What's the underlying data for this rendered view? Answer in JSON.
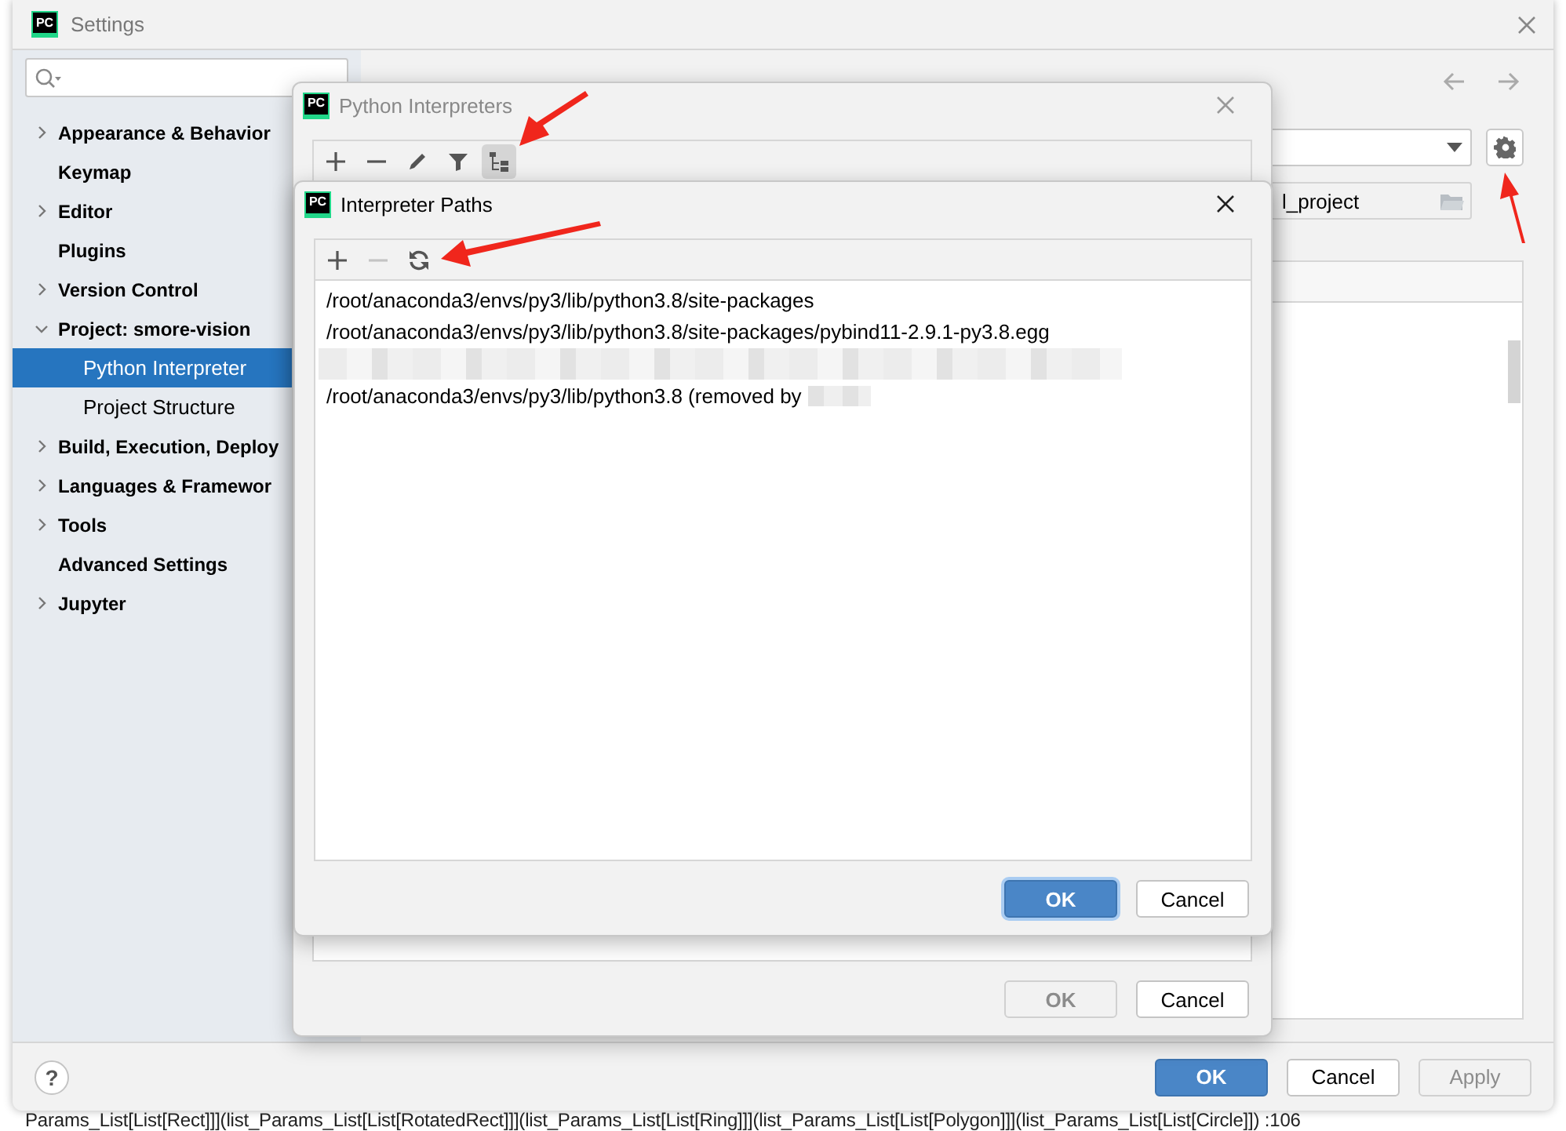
{
  "background_text": "Params_List[List[Rect]]](list_Params_List[List[RotatedRect]]](list_Params_List[List[Ring]]](list_Params_List[List[Polygon]]](list_Params_List[List[Circle]]) :106",
  "window": {
    "logo": "PC",
    "title": "Settings"
  },
  "sidebar": {
    "items": [
      {
        "label": "Appearance & Behavior",
        "kind": "group",
        "expanded": false,
        "selected": false
      },
      {
        "label": "Keymap",
        "kind": "page",
        "selected": false
      },
      {
        "label": "Editor",
        "kind": "group",
        "expanded": false,
        "selected": false
      },
      {
        "label": "Plugins",
        "kind": "page",
        "selected": false
      },
      {
        "label": "Version Control",
        "kind": "group",
        "expanded": false,
        "selected": false
      },
      {
        "label": "Project: smore-vision",
        "kind": "group",
        "expanded": true,
        "selected": false,
        "children": [
          {
            "label": "Python Interpreter",
            "selected": true
          },
          {
            "label": "Project Structure",
            "selected": false
          }
        ]
      },
      {
        "label": "Build, Execution, Deploy",
        "kind": "group",
        "expanded": false,
        "selected": false
      },
      {
        "label": "Languages & Framewor",
        "kind": "group",
        "expanded": false,
        "selected": false
      },
      {
        "label": "Tools",
        "kind": "group",
        "expanded": false,
        "selected": false
      },
      {
        "label": "Advanced Settings",
        "kind": "page",
        "selected": false
      },
      {
        "label": "Jupyter",
        "kind": "group",
        "expanded": false,
        "selected": false
      }
    ]
  },
  "content": {
    "project_field": {
      "value": "l_project"
    }
  },
  "help_button": {
    "label": "?"
  },
  "buttons": [
    {
      "label": "OK",
      "kind": "primary",
      "disabled": false
    },
    {
      "label": "Cancel",
      "kind": "normal",
      "disabled": false
    },
    {
      "label": "Apply",
      "kind": "normal",
      "disabled": true
    }
  ],
  "dialogs": [
    {
      "logo": "PC",
      "title": "Python Interpreters",
      "active": false,
      "toolbar": [
        {
          "kind": "add",
          "selected": false
        },
        {
          "kind": "remove",
          "selected": false
        },
        {
          "kind": "edit",
          "selected": false
        },
        {
          "kind": "filter",
          "selected": false
        },
        {
          "kind": "tree",
          "selected": true
        }
      ],
      "buttons": [
        {
          "label": "OK",
          "kind": "primary",
          "disabled": true,
          "focused": false
        },
        {
          "label": "Cancel",
          "kind": "normal",
          "disabled": false,
          "focused": false
        }
      ]
    },
    {
      "logo": "PC",
      "title": "Interpreter Paths",
      "active": true,
      "toolbar": [
        {
          "kind": "add",
          "disabled": false
        },
        {
          "kind": "remove",
          "disabled": true
        },
        {
          "kind": "refresh",
          "disabled": false
        }
      ],
      "paths": [
        {
          "kind": "path",
          "text": "/root/anaconda3/envs/py3/lib/python3.8/site-packages"
        },
        {
          "kind": "path",
          "text": "/root/anaconda3/envs/py3/lib/python3.8/site-packages/pybind11-2.9.1-py3.8.egg"
        },
        {
          "kind": "redacted"
        },
        {
          "kind": "path-redacted-end",
          "text": "/root/anaconda3/envs/py3/lib/python3.8  (removed by"
        }
      ],
      "buttons": [
        {
          "label": "OK",
          "kind": "primary",
          "disabled": false,
          "focused": true
        },
        {
          "label": "Cancel",
          "kind": "normal",
          "disabled": false,
          "focused": false
        }
      ]
    }
  ]
}
